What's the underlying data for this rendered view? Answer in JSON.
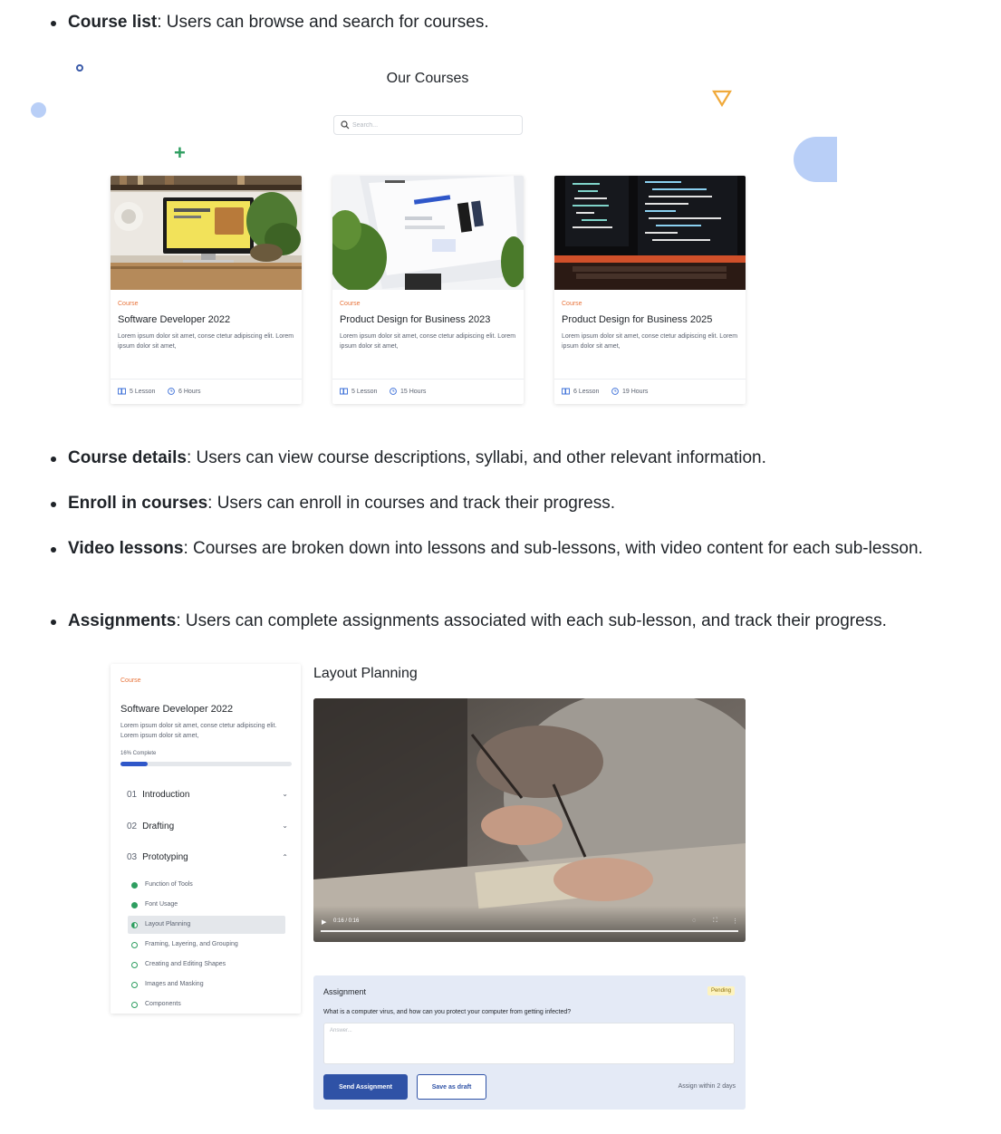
{
  "bullets": [
    {
      "term": "Course list",
      "text": ": Users can browse and search for courses."
    },
    {
      "term": "Course details",
      "text": ": Users can view course descriptions, syllabi, and other relevant information."
    },
    {
      "term": "Enroll in courses",
      "text": ": Users can enroll in courses and track their progress."
    },
    {
      "term": "Video lessons",
      "text": ": Courses are broken down into lessons and sub-lessons, with video content for each sub-lesson."
    },
    {
      "term": "Assignments",
      "text": ": Users can complete assignments associated with each sub-lesson, and track their progress."
    }
  ],
  "courses_page": {
    "title": "Our Courses",
    "search_placeholder": "Search...",
    "cards": [
      {
        "tag": "Course",
        "title": "Software Developer 2022",
        "desc": "Lorem ipsum dolor sit amet, conse ctetur adipiscing elit. Lorem ipsum dolor sit amet,",
        "lessons": "5 Lesson",
        "hours": "6 Hours",
        "image": "desk-computer-yellow-screen"
      },
      {
        "tag": "Course",
        "title": "Product Design for Business 2023",
        "desc": "Lorem ipsum dolor sit amet, conse ctetur adipiscing elit. Lorem ipsum dolor sit amet,",
        "lessons": "5 Lesson",
        "hours": "15 Hours",
        "image": "monitor-with-plant"
      },
      {
        "tag": "Course",
        "title": "Product Design for Business 2025",
        "desc": "Lorem ipsum dolor sit amet, conse ctetur adipiscing elit. Lorem ipsum dolor sit amet,",
        "lessons": "6 Lesson",
        "hours": "19 Hours",
        "image": "code-on-dark-monitor"
      }
    ]
  },
  "lesson_page": {
    "sidebar": {
      "tag": "Course",
      "title": "Software Developer 2022",
      "desc": "Lorem ipsum dolor sit amet, conse ctetur adipiscing elit. Lorem ipsum dolor sit amet,",
      "progress_label": "16% Complete",
      "progress": 0.16,
      "sections": [
        {
          "num": "01",
          "label": "Introduction",
          "expanded": false
        },
        {
          "num": "02",
          "label": "Drafting",
          "expanded": false
        },
        {
          "num": "03",
          "label": "Prototyping",
          "expanded": true
        }
      ],
      "sublessons": [
        {
          "label": "Function of Tools",
          "status": "done"
        },
        {
          "label": "Font Usage",
          "status": "done"
        },
        {
          "label": "Layout Planning",
          "status": "current"
        },
        {
          "label": "Framing, Layering, and Grouping",
          "status": "todo"
        },
        {
          "label": "Creating and Editing Shapes",
          "status": "todo"
        },
        {
          "label": "Images and Masking",
          "status": "todo"
        },
        {
          "label": "Components",
          "status": "todo"
        }
      ]
    },
    "lesson_title": "Layout Planning",
    "video": {
      "time": "0:16 / 0:16",
      "progress": 1.0
    },
    "assignment": {
      "heading": "Assignment",
      "status": "Pending",
      "question": "What is a computer virus, and how can you protect your computer from getting infected?",
      "answer_placeholder": "Answer...",
      "send_label": "Send Assignment",
      "draft_label": "Save as draft",
      "due": "Assign within 2 days"
    }
  },
  "colors": {
    "accent": "#2f52a6",
    "tag": "#e8743b",
    "done": "#2e9e60",
    "pending_bg": "#fdf3bf"
  }
}
